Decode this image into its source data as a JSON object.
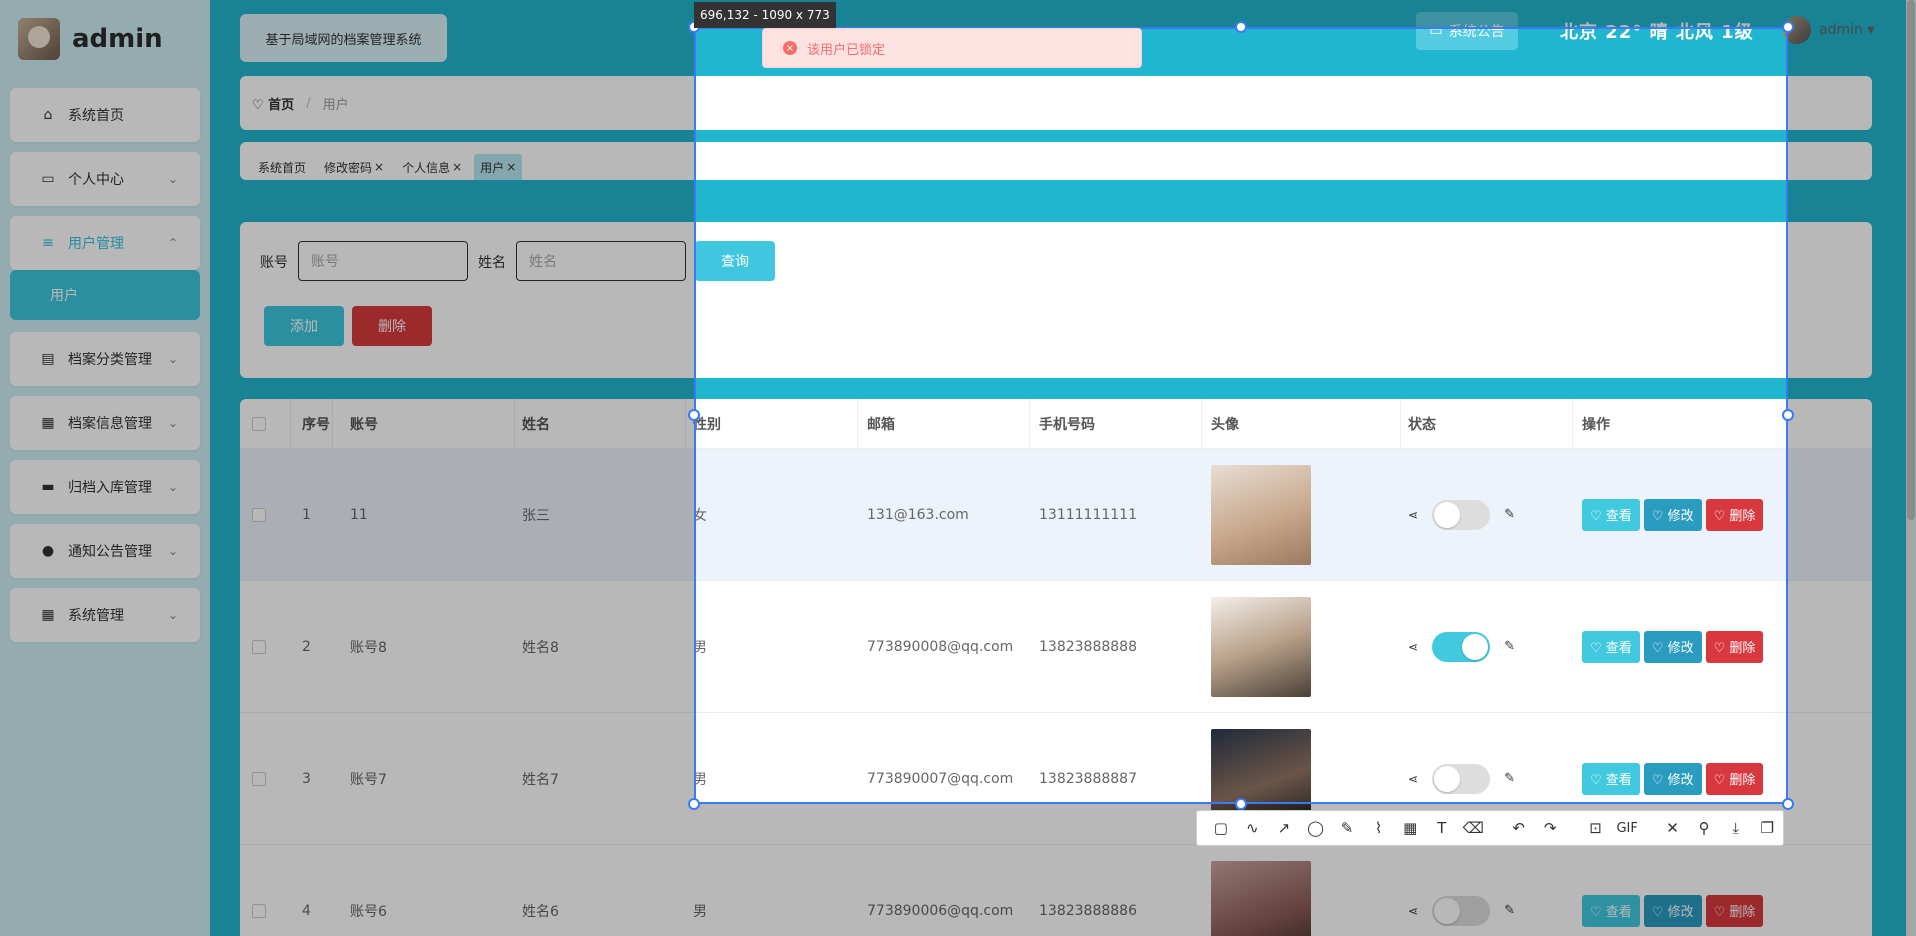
{
  "app": {
    "username": "admin",
    "system_title": "基于局域网的档案管理系统"
  },
  "sidebar": {
    "items": [
      {
        "label": "系统首页",
        "icon": "home-icon",
        "glyph": "⌂"
      },
      {
        "label": "个人中心",
        "icon": "card-icon",
        "glyph": "▭"
      },
      {
        "label": "用户管理",
        "icon": "list-icon",
        "glyph": "≡"
      },
      {
        "label": "档案分类管理",
        "icon": "clipboard-icon",
        "glyph": "▤"
      },
      {
        "label": "档案信息管理",
        "icon": "grid-icon",
        "glyph": "▦"
      },
      {
        "label": "归档入库管理",
        "icon": "monitor-icon",
        "glyph": "▬"
      },
      {
        "label": "通知公告管理",
        "icon": "pin-icon",
        "glyph": "●"
      },
      {
        "label": "系统管理",
        "icon": "grid-icon",
        "glyph": "▦"
      }
    ],
    "sub_item": "用户"
  },
  "header": {
    "notice_label": "系统公告",
    "weather": "北京 22° 晴 北风 1级",
    "user_label": "admin ▾"
  },
  "breadcrumb": {
    "home": "♡ 首页",
    "sep": "/",
    "current": "用户"
  },
  "tabs": [
    "系统首页",
    "修改密码",
    "个人信息",
    "用户"
  ],
  "search": {
    "account_label": "账号",
    "account_placeholder": "账号",
    "name_label": "姓名",
    "name_placeholder": "姓名",
    "query_label": "查询",
    "add_label": "添加",
    "delete_label": "删除"
  },
  "table": {
    "columns": [
      "序号",
      "账号",
      "姓名",
      "性别",
      "邮箱",
      "手机号码",
      "头像",
      "状态",
      "操作"
    ],
    "rows": [
      {
        "no": "1",
        "account": "11",
        "name": "张三",
        "gender": "女",
        "email": "131@163.com",
        "phone": "13111111111",
        "status_on": false
      },
      {
        "no": "2",
        "account": "账号8",
        "name": "姓名8",
        "gender": "男",
        "email": "773890008@qq.com",
        "phone": "13823888888",
        "status_on": true
      },
      {
        "no": "3",
        "account": "账号7",
        "name": "姓名7",
        "gender": "男",
        "email": "773890007@qq.com",
        "phone": "13823888887",
        "status_on": false
      },
      {
        "no": "4",
        "account": "账号6",
        "name": "姓名6",
        "gender": "男",
        "email": "773890006@qq.com",
        "phone": "13823888886",
        "status_on": false
      }
    ],
    "actions": {
      "view": "♡ 查看",
      "edit": "♡ 修改",
      "delete": "♡ 删除"
    }
  },
  "overlay": {
    "size_label": "696,132 - 1090 x 773",
    "toast": "该用户已锁定",
    "toolbar": [
      "rect-icon",
      "curve-icon",
      "arrow-icon",
      "circle-icon",
      "pen-icon",
      "marker-icon",
      "mosaic-icon",
      "text-icon",
      "eraser-icon",
      "undo-icon",
      "redo-icon",
      "ocr-icon",
      "GIF",
      "close-icon",
      "pin-icon",
      "download-icon",
      "copy-icon"
    ]
  },
  "colors": {
    "primary": "#20b6cf",
    "danger": "#d9393e",
    "info": "#2a9cc0",
    "accent": "#41c9df",
    "selection": "#3a7bf5"
  }
}
